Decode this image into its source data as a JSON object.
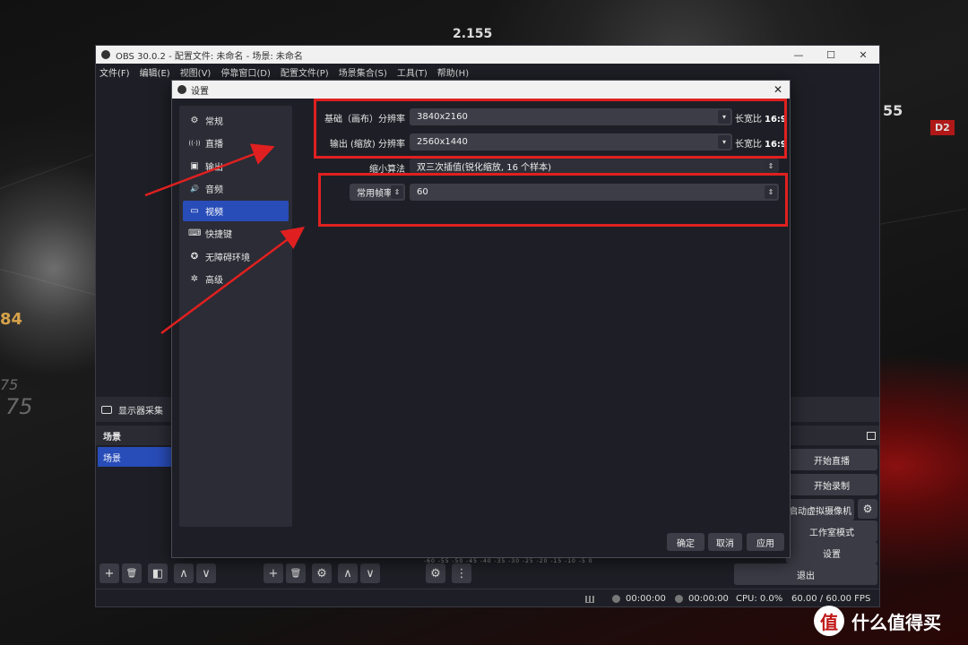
{
  "background": {
    "numbers": [
      "2.155",
      "55",
      "84",
      "75",
      "75"
    ],
    "badge": "D2"
  },
  "obs": {
    "title": "OBS 30.0.2 - 配置文件: 未命名 - 场景: 未命名",
    "window_buttons": [
      "—",
      "☐",
      "✕"
    ],
    "menu": [
      "文件(F)",
      "编辑(E)",
      "视图(V)",
      "停靠窗口(D)",
      "配置文件(P)",
      "场景集合(S)",
      "工具(T)",
      "帮助(H)"
    ],
    "source_label": "显示器采集",
    "scenes_header": "场景",
    "scene_item": "场景",
    "bottom_tools": [
      "+",
      "🗑",
      "◧",
      "∧",
      "∨",
      "+",
      "🗑",
      "⚙",
      "∧",
      "∨",
      "⚙",
      "⋮"
    ],
    "mixer_scale": "-60 -55 -50 -45 -40 -35 -30 -25 -20 -15 -10 -5 0",
    "controls": [
      "开始直播",
      "开始录制",
      "启动虚拟摄像机",
      "工作室模式",
      "设置",
      "退出"
    ],
    "status": {
      "time_live": "00:00:00",
      "time_rec": "00:00:00",
      "cpu": "CPU: 0.0%",
      "fps": "60.00 / 60.00 FPS"
    }
  },
  "settings": {
    "title": "设置",
    "close": "✕",
    "nav": [
      {
        "label": "常规",
        "icon": "⚙"
      },
      {
        "label": "直播",
        "icon": "((·))"
      },
      {
        "label": "输出",
        "icon": "▣"
      },
      {
        "label": "音频",
        "icon": "🔊"
      },
      {
        "label": "视频",
        "icon": "▭"
      },
      {
        "label": "快捷键",
        "icon": "⌨"
      },
      {
        "label": "无障碍环境",
        "icon": "✪"
      },
      {
        "label": "高级",
        "icon": "✲"
      }
    ],
    "video": {
      "base_label": "基础（画布）分辨率",
      "base_value": "3840x2160",
      "output_label": "输出 (缩放) 分辨率",
      "output_value": "2560x1440",
      "aspect_label": "长宽比",
      "aspect_value": "16:9",
      "downscale_label": "缩小算法",
      "downscale_value": "双三次插值(锐化缩放, 16 个样本)",
      "fps_type": "常用帧率",
      "fps_value": "60"
    },
    "buttons": {
      "ok": "确定",
      "cancel": "取消",
      "apply": "应用"
    }
  },
  "watermark": {
    "logo": "值",
    "text": "什么值得买"
  },
  "colors": {
    "accent": "#284cb8",
    "annotation": "#e02020"
  }
}
